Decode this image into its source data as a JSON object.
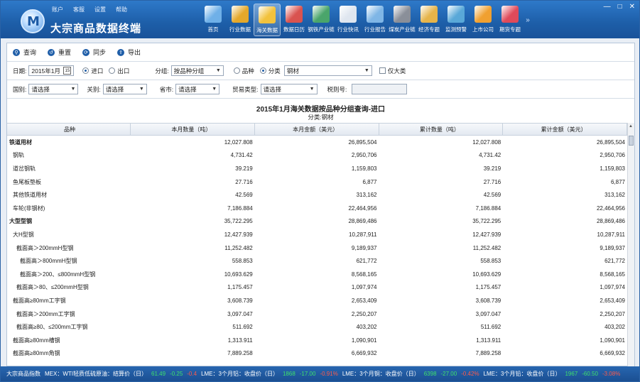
{
  "app": {
    "title": "大宗商品数据终端",
    "logo_letter": "M",
    "menu": [
      "账户",
      "客服",
      "设置",
      "帮助"
    ],
    "window_controls": [
      "—",
      "□",
      "✕"
    ]
  },
  "toolbar": [
    {
      "label": "首页",
      "icon": "home-icon",
      "color": "#6fb0e8"
    },
    {
      "label": "行业数据",
      "icon": "bar-chart-icon",
      "color": "#e5a82a"
    },
    {
      "label": "海关数据",
      "icon": "customs-icon",
      "color": "#f2c23c",
      "active": true
    },
    {
      "label": "数据日历",
      "icon": "calendar-icon",
      "color": "#d9534f"
    },
    {
      "label": "钢铁产业链",
      "icon": "steel-icon",
      "color": "#4aa56b"
    },
    {
      "label": "行业快讯",
      "icon": "news-icon",
      "color": "#dfe6ef"
    },
    {
      "label": "行业报告",
      "icon": "report-icon",
      "color": "#7fb6e6"
    },
    {
      "label": "煤炭产业链",
      "icon": "coal-icon",
      "color": "#8a8f99"
    },
    {
      "label": "经济专题",
      "icon": "economy-icon",
      "color": "#e6b44a"
    },
    {
      "label": "监测预警",
      "icon": "monitor-icon",
      "color": "#59a8d8"
    },
    {
      "label": "上市公司",
      "icon": "company-icon",
      "color": "#f0a030"
    },
    {
      "label": "期货专题",
      "icon": "futures-icon",
      "color": "#e04a5a"
    }
  ],
  "actions": [
    {
      "label": "查询",
      "icon": "search-icon",
      "glyph": "⚲"
    },
    {
      "label": "重置",
      "icon": "reset-icon",
      "glyph": "↺"
    },
    {
      "label": "同步",
      "icon": "sync-icon",
      "glyph": "⟳"
    },
    {
      "label": "导出",
      "icon": "export-icon",
      "glyph": "⇪"
    }
  ],
  "filters": {
    "date_label": "日期:",
    "date_value": "2015年1月",
    "cal_glyph": "15",
    "import_label": "进口",
    "export_label": "出口",
    "group_label": "分组:",
    "group_value": "按品种分组",
    "variety_label": "品种",
    "category_label": "分类",
    "category_value": "钢材",
    "only_big_label": "仅大类",
    "country_label": "国别:",
    "country_value": "请选择",
    "customs_label": "关别:",
    "customs_value": "请选择",
    "province_label": "省市:",
    "province_value": "请选择",
    "trade_label": "贸易类型:",
    "trade_value": "请选择",
    "tax_label": "税则号:",
    "tax_value": ""
  },
  "report": {
    "title": "2015年1月海关数据按品种分组查询-进口",
    "subtitle": "分类:钢材",
    "columns": [
      "品种",
      "本月数量（吨）",
      "本月金额（美元）",
      "累计数量（吨）",
      "累计金额（美元）"
    ],
    "rows": [
      {
        "name": "铁道用材",
        "indent": 0,
        "bold": true,
        "v": [
          "12,027.808",
          "26,895,504",
          "12,027.808",
          "26,895,504"
        ]
      },
      {
        "name": "钢轨",
        "indent": 1,
        "v": [
          "4,731.42",
          "2,950,706",
          "4,731.42",
          "2,950,706"
        ]
      },
      {
        "name": "道岔钢轨",
        "indent": 1,
        "v": [
          "39.219",
          "1,159,803",
          "39.219",
          "1,159,803"
        ]
      },
      {
        "name": "鱼尾板垫板",
        "indent": 1,
        "v": [
          "27.716",
          "6,877",
          "27.716",
          "6,877"
        ]
      },
      {
        "name": "其他铁道用材",
        "indent": 1,
        "v": [
          "42.569",
          "313,162",
          "42.569",
          "313,162"
        ]
      },
      {
        "name": "车轮(非钢材)",
        "indent": 1,
        "v": [
          "7,186.884",
          "22,464,956",
          "7,186.884",
          "22,464,956"
        ]
      },
      {
        "name": "大型型钢",
        "indent": 0,
        "bold": true,
        "v": [
          "35,722.295",
          "28,869,486",
          "35,722.295",
          "28,869,486"
        ]
      },
      {
        "name": "大H型钢",
        "indent": 1,
        "v": [
          "12,427.939",
          "10,287,911",
          "12,427.939",
          "10,287,911"
        ]
      },
      {
        "name": "截面高＞200mmH型钢",
        "indent": 2,
        "v": [
          "11,252.482",
          "9,189,937",
          "11,252.482",
          "9,189,937"
        ]
      },
      {
        "name": "截面高＞800mmH型钢",
        "indent": 3,
        "v": [
          "558.853",
          "621,772",
          "558.853",
          "621,772"
        ]
      },
      {
        "name": "截面高＞200、≤800mmH型钢",
        "indent": 3,
        "v": [
          "10,693.629",
          "8,568,165",
          "10,693.629",
          "8,568,165"
        ]
      },
      {
        "name": "截面高＞80、≤200mmH型钢",
        "indent": 2,
        "v": [
          "1,175.457",
          "1,097,974",
          "1,175.457",
          "1,097,974"
        ]
      },
      {
        "name": "截面高≥80mm工字钢",
        "indent": 1,
        "v": [
          "3,608.739",
          "2,653,409",
          "3,608.739",
          "2,653,409"
        ]
      },
      {
        "name": "截面高＞200mm工字钢",
        "indent": 2,
        "v": [
          "3,097.047",
          "2,250,207",
          "3,097.047",
          "2,250,207"
        ]
      },
      {
        "name": "截面高≥80、≤200mm工字钢",
        "indent": 2,
        "v": [
          "511.692",
          "403,202",
          "511.692",
          "403,202"
        ]
      },
      {
        "name": "截面高≥80mm槽钢",
        "indent": 1,
        "v": [
          "1,313.911",
          "1,090,901",
          "1,313.911",
          "1,090,901"
        ]
      },
      {
        "name": "截面高≥80mm角钢",
        "indent": 1,
        "v": [
          "7,889.258",
          "6,669,932",
          "7,889.258",
          "6,669,932"
        ]
      }
    ]
  },
  "status": {
    "label": "大宗商品指数",
    "items": [
      {
        "name": "MEX：WTI轻质低硫原油：结算价（日）",
        "price": "61.49",
        "chg": "-0.25",
        "pct": "-0.4"
      },
      {
        "name": "LME：3个月铝：收盘价（日）",
        "price": "1868",
        "chg": "-17.00",
        "pct": "-0.91%"
      },
      {
        "name": "LME：3个月铜：收盘价（日）",
        "price": "6398",
        "chg": "-27.00",
        "pct": "-0.42%"
      },
      {
        "name": "LME：3个月铅：收盘价（日）",
        "price": "1967",
        "chg": "-60.50",
        "pct": "-3.08%"
      }
    ]
  }
}
